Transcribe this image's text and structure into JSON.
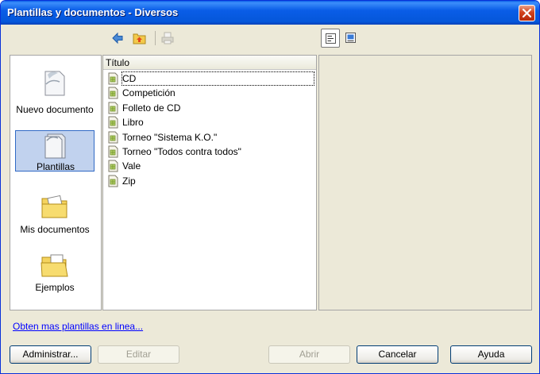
{
  "window": {
    "title": "Plantillas y documentos - Diversos"
  },
  "toolbar": {
    "back_icon": "back-arrow-icon",
    "up_icon": "folder-up-icon",
    "print_icon": "print-icon",
    "view_details_icon": "document-view-icon",
    "view_preview_icon": "preview-icon"
  },
  "categories": [
    {
      "label": "Nuevo documento",
      "icon": "new-document-icon",
      "selected": false
    },
    {
      "label": "Plantillas",
      "icon": "templates-icon",
      "selected": true
    },
    {
      "label": "Mis documentos",
      "icon": "my-documents-icon",
      "selected": false
    },
    {
      "label": "Ejemplos",
      "icon": "examples-folder-icon",
      "selected": false
    }
  ],
  "file_list": {
    "column_header": "Título",
    "items": [
      {
        "name": "CD",
        "icon": "template-file-icon"
      },
      {
        "name": "Competición",
        "icon": "template-file-icon"
      },
      {
        "name": "Folleto de CD",
        "icon": "template-file-icon"
      },
      {
        "name": "Libro",
        "icon": "template-file-icon"
      },
      {
        "name": "Torneo \"Sistema K.O.\"",
        "icon": "template-file-icon"
      },
      {
        "name": "Torneo \"Todos contra todos\"",
        "icon": "template-file-icon"
      },
      {
        "name": "Vale",
        "icon": "template-file-icon"
      },
      {
        "name": "Zip",
        "icon": "template-file-icon"
      }
    ]
  },
  "more_link": "Obten mas plantillas en linea...",
  "buttons": {
    "manage": "Administrar...",
    "edit": "Editar",
    "open": "Abrir",
    "cancel": "Cancelar",
    "help": "Ayuda"
  },
  "colors": {
    "title_bar": "#0a5de7",
    "dialog_bg": "#ece9d8",
    "selection": "#c1d2ee",
    "link": "#0000ff"
  }
}
